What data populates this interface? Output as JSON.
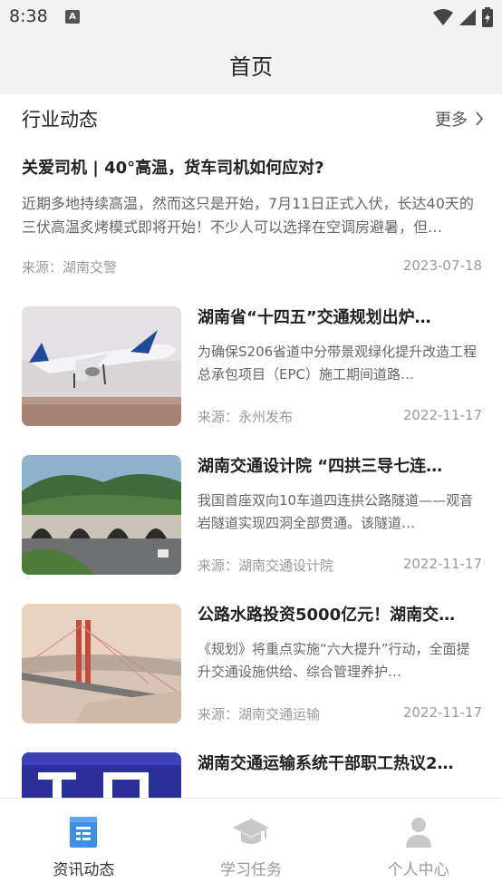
{
  "status_bar": {
    "time": "8:38",
    "notification_badge": "A"
  },
  "app_bar": {
    "title": "首页"
  },
  "section": {
    "title": "行业动态",
    "more_label": "更多"
  },
  "featured": {
    "title": "关爱司机 | 40°高温，货车司机如何应对?",
    "summary": "近期多地持续高温，然而这只是开始，7月11日正式入伏，长达40天的三伏高温炙烤模式即将开始！不少人可以选择在空调房避暑，但…",
    "source": "来源：湖南交警",
    "date": "2023-07-18"
  },
  "news": [
    {
      "title": "湖南省“十四五”交通规划出炉…",
      "summary": "为确保S206省道中分带景观绿化提升改造工程总承包项目（EPC）施工期间道路…",
      "source": "来源：永州发布",
      "date": "2022-11-17",
      "image": "airplane-photo"
    },
    {
      "title": "湖南交通设计院 “四拱三导七连…",
      "summary": "我国首座双向10车道四连拱公路隧道——观音岩隧道实现四洞全部贯通。该隧道…",
      "source": "来源：湖南交通设计院",
      "date": "2022-11-17",
      "image": "tunnel-photo"
    },
    {
      "title": "公路水路投资5000亿元！湖南交…",
      "summary": "《规划》将重点实施“六大提升”行动，全面提升交通设施供给、综合管理养护…",
      "source": "来源：湖南交通运输",
      "date": "2022-11-17",
      "image": "bridge-photo"
    },
    {
      "title": "湖南交通运输系统干部职工热议2…",
      "image": "poster-photo"
    }
  ],
  "bottom_nav": [
    {
      "label": "资讯动态",
      "icon": "news-icon",
      "active": true
    },
    {
      "label": "学习任务",
      "icon": "graduation-cap-icon",
      "active": false
    },
    {
      "label": "个人中心",
      "icon": "person-icon",
      "active": false
    }
  ],
  "colors": {
    "accent": "#3b8fe8",
    "inactive": "#c8c8c8",
    "header_bg": "#f2f2f2"
  }
}
